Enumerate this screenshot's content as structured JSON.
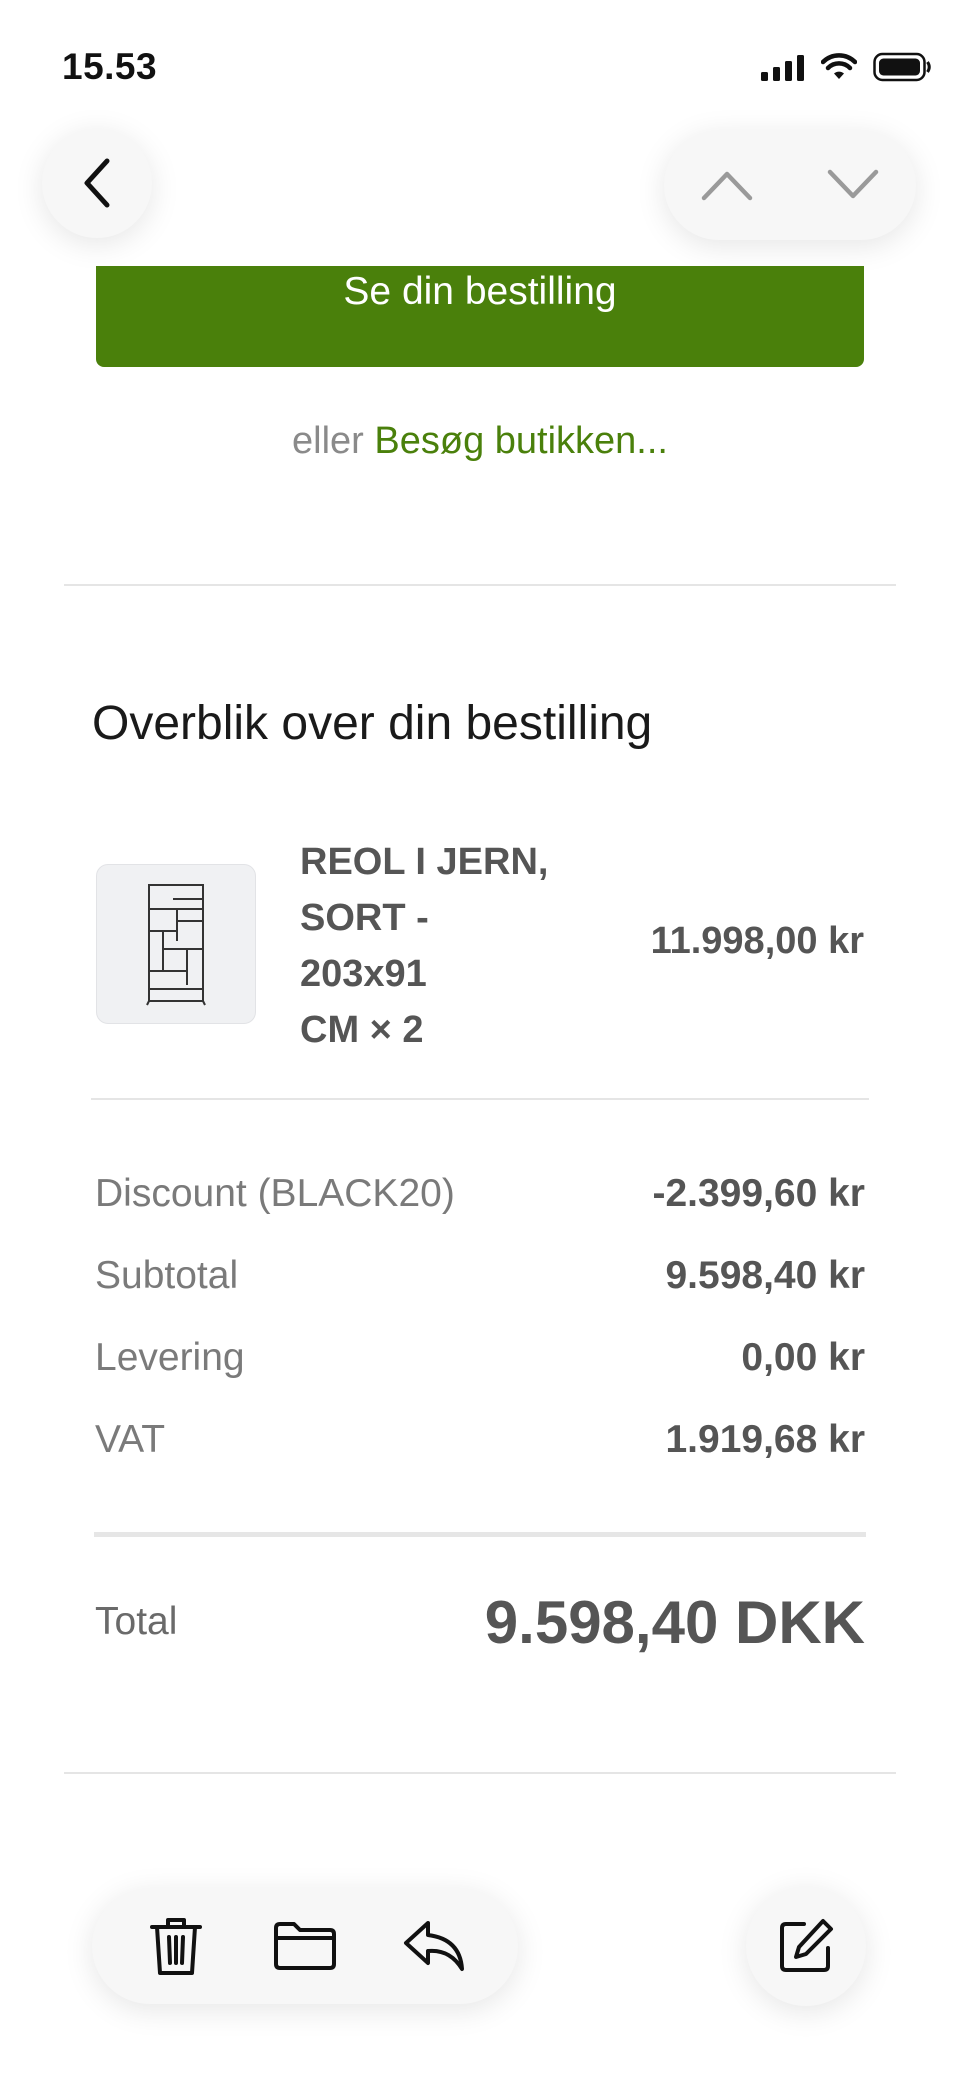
{
  "status": {
    "time": "15.53"
  },
  "order": {
    "cta_label": "Se din bestilling",
    "or_text": "eller",
    "visit_link": "Besøg butikken..."
  },
  "summary": {
    "title": "Overblik over din bestilling",
    "item": {
      "name_lines": [
        "REOL I JERN,",
        "SORT -",
        "203x91",
        "CM × 2"
      ],
      "price": "11.998,00 kr"
    },
    "rows": [
      {
        "label": "Discount (BLACK20)",
        "value": "-2.399,60 kr"
      },
      {
        "label": "Subtotal",
        "value": "9.598,40 kr"
      },
      {
        "label": "Levering",
        "value": "0,00 kr"
      },
      {
        "label": "VAT",
        "value": "1.919,68 kr"
      }
    ],
    "total_label": "Total",
    "total_value": "9.598,40 DKK"
  },
  "icons": {
    "back": "chevron-left-icon",
    "up": "chevron-up-icon",
    "down": "chevron-down-icon",
    "trash": "trash-icon",
    "folder": "folder-icon",
    "reply": "reply-icon",
    "compose": "compose-icon"
  },
  "colors": {
    "brand_green": "#4a800b"
  }
}
